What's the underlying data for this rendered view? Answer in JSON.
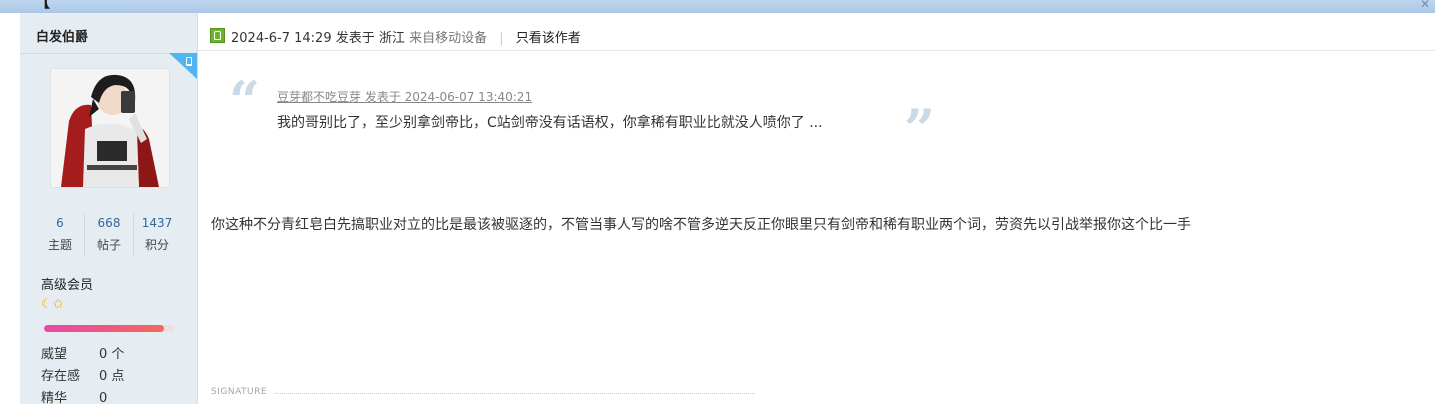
{
  "thread_title_partial": "【",
  "user": {
    "name": "白发伯爵",
    "stats": [
      {
        "num": "6",
        "label": "主题"
      },
      {
        "num": "668",
        "label": "帖子"
      },
      {
        "num": "1437",
        "label": "积分"
      }
    ],
    "level": "高级会员",
    "level_progress": 0.92,
    "props": [
      {
        "key": "威望",
        "value": "0 个"
      },
      {
        "key": "存在感",
        "value": "0 点"
      },
      {
        "key": "精华",
        "value": "0"
      }
    ]
  },
  "post": {
    "datetime": "2024-6-7 14:29",
    "posted_in": "发表于",
    "location": "浙江",
    "device": "来自移动设备",
    "only_author": "只看该作者",
    "quote": {
      "source": "豆芽都不吃豆芽 发表于 2024-06-07 13:40:21",
      "text": "我的哥别比了，至少别拿剑帝比，C站剑帝没有话语权，你拿稀有职业比就没人喷你了 ..."
    },
    "message": "你这种不分青红皂白先搞职业对立的比是最该被驱逐的，不管当事人写的啥不管多逆天反正你眼里只有剑帝和稀有职业两个词，劳资先以引战举报你这个比一手",
    "signature_label": "SIGNATURE"
  },
  "colors": {
    "side_bg": "#e5edf2",
    "online_icon": "#6bb32d",
    "progress": "#e64aa6"
  },
  "icons": [
    "online-user-icon",
    "device-corner-icon",
    "moon-medal-icon",
    "star-medal-icon",
    "quote-open-icon",
    "quote-close-icon"
  ]
}
